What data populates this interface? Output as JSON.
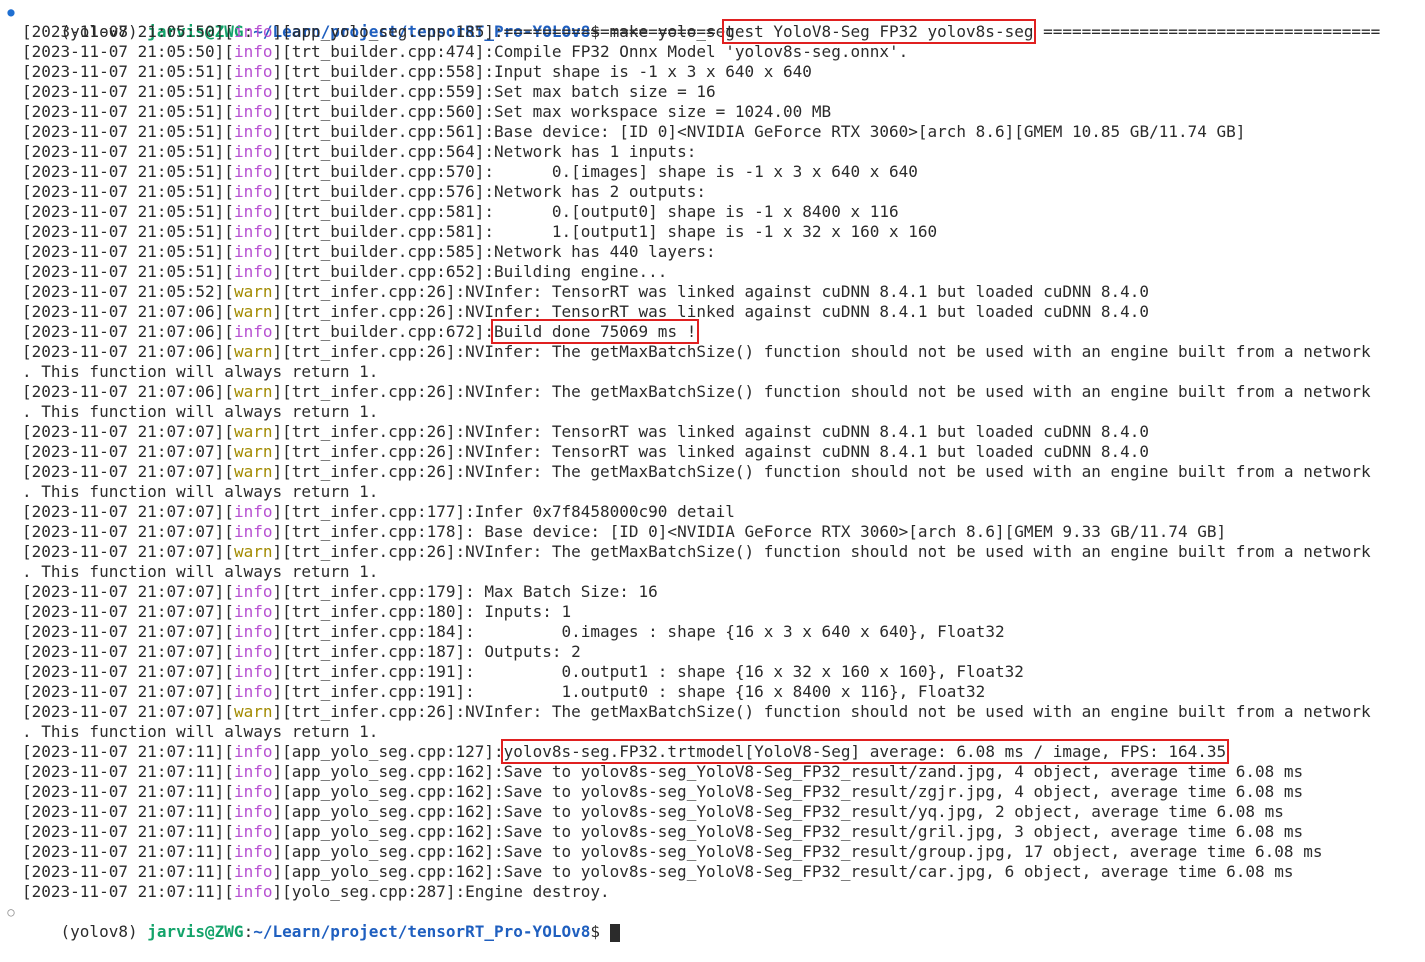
{
  "prompt": {
    "env": "(yolov8)",
    "user_host": "jarvis@ZWG",
    "path": "~/Learn/project/tensorRT_Pro-YOLOv8",
    "dollar": "$",
    "command": "make yolo_seg"
  },
  "lines": [
    {
      "ts": "[2023-11-07 21:05:50]",
      "level": "info",
      "src": "[app_yolo_seg.cpp:185]",
      "pre": ":====================== ",
      "hl": "test YoloV8-Seg FP32 yolov8s-seg",
      "post": " ==================================="
    },
    {
      "ts": "[2023-11-07 21:05:50]",
      "level": "info",
      "src": "[trt_builder.cpp:474]",
      "pre": ":Compile FP32 Onnx Model 'yolov8s-seg.onnx'."
    },
    {
      "ts": "[2023-11-07 21:05:51]",
      "level": "info",
      "src": "[trt_builder.cpp:558]",
      "pre": ":Input shape is -1 x 3 x 640 x 640"
    },
    {
      "ts": "[2023-11-07 21:05:51]",
      "level": "info",
      "src": "[trt_builder.cpp:559]",
      "pre": ":Set max batch size = 16"
    },
    {
      "ts": "[2023-11-07 21:05:51]",
      "level": "info",
      "src": "[trt_builder.cpp:560]",
      "pre": ":Set max workspace size = 1024.00 MB"
    },
    {
      "ts": "[2023-11-07 21:05:51]",
      "level": "info",
      "src": "[trt_builder.cpp:561]",
      "pre": ":Base device: [ID 0]<NVIDIA GeForce RTX 3060>[arch 8.6][GMEM 10.85 GB/11.74 GB]"
    },
    {
      "ts": "[2023-11-07 21:05:51]",
      "level": "info",
      "src": "[trt_builder.cpp:564]",
      "pre": ":Network has 1 inputs:"
    },
    {
      "ts": "[2023-11-07 21:05:51]",
      "level": "info",
      "src": "[trt_builder.cpp:570]",
      "pre": ":      0.[images] shape is -1 x 3 x 640 x 640"
    },
    {
      "ts": "[2023-11-07 21:05:51]",
      "level": "info",
      "src": "[trt_builder.cpp:576]",
      "pre": ":Network has 2 outputs:"
    },
    {
      "ts": "[2023-11-07 21:05:51]",
      "level": "info",
      "src": "[trt_builder.cpp:581]",
      "pre": ":      0.[output0] shape is -1 x 8400 x 116"
    },
    {
      "ts": "[2023-11-07 21:05:51]",
      "level": "info",
      "src": "[trt_builder.cpp:581]",
      "pre": ":      1.[output1] shape is -1 x 32 x 160 x 160"
    },
    {
      "ts": "[2023-11-07 21:05:51]",
      "level": "info",
      "src": "[trt_builder.cpp:585]",
      "pre": ":Network has 440 layers:"
    },
    {
      "ts": "[2023-11-07 21:05:51]",
      "level": "info",
      "src": "[trt_builder.cpp:652]",
      "pre": ":Building engine..."
    },
    {
      "ts": "[2023-11-07 21:05:52]",
      "level": "warn",
      "src": "[trt_infer.cpp:26]",
      "pre": ":NVInfer: TensorRT was linked against cuDNN 8.4.1 but loaded cuDNN 8.4.0"
    },
    {
      "ts": "[2023-11-07 21:07:06]",
      "level": "warn",
      "src": "[trt_infer.cpp:26]",
      "pre": ":NVInfer: TensorRT was linked against cuDNN 8.4.1 but loaded cuDNN 8.4.0"
    },
    {
      "ts": "[2023-11-07 21:07:06]",
      "level": "info",
      "src": "[trt_builder.cpp:672]",
      "pre": ":",
      "hl": "Build done 75069 ms !",
      "post": ""
    },
    {
      "ts": "[2023-11-07 21:07:06]",
      "level": "warn",
      "src": "[trt_infer.cpp:26]",
      "pre": ":NVInfer: The getMaxBatchSize() function should not be used with an engine built from a network"
    },
    {
      "wrap": ". This function will always return 1."
    },
    {
      "ts": "[2023-11-07 21:07:06]",
      "level": "warn",
      "src": "[trt_infer.cpp:26]",
      "pre": ":NVInfer: The getMaxBatchSize() function should not be used with an engine built from a network"
    },
    {
      "wrap": ". This function will always return 1."
    },
    {
      "ts": "[2023-11-07 21:07:07]",
      "level": "warn",
      "src": "[trt_infer.cpp:26]",
      "pre": ":NVInfer: TensorRT was linked against cuDNN 8.4.1 but loaded cuDNN 8.4.0"
    },
    {
      "ts": "[2023-11-07 21:07:07]",
      "level": "warn",
      "src": "[trt_infer.cpp:26]",
      "pre": ":NVInfer: TensorRT was linked against cuDNN 8.4.1 but loaded cuDNN 8.4.0"
    },
    {
      "ts": "[2023-11-07 21:07:07]",
      "level": "warn",
      "src": "[trt_infer.cpp:26]",
      "pre": ":NVInfer: The getMaxBatchSize() function should not be used with an engine built from a network"
    },
    {
      "wrap": ". This function will always return 1."
    },
    {
      "ts": "[2023-11-07 21:07:07]",
      "level": "info",
      "src": "[trt_infer.cpp:177]",
      "pre": ":Infer 0x7f8458000c90 detail"
    },
    {
      "ts": "[2023-11-07 21:07:07]",
      "level": "info",
      "src": "[trt_infer.cpp:178]",
      "pre": ": Base device: [ID 0]<NVIDIA GeForce RTX 3060>[arch 8.6][GMEM 9.33 GB/11.74 GB]"
    },
    {
      "ts": "[2023-11-07 21:07:07]",
      "level": "warn",
      "src": "[trt_infer.cpp:26]",
      "pre": ":NVInfer: The getMaxBatchSize() function should not be used with an engine built from a network"
    },
    {
      "wrap": ". This function will always return 1."
    },
    {
      "ts": "[2023-11-07 21:07:07]",
      "level": "info",
      "src": "[trt_infer.cpp:179]",
      "pre": ": Max Batch Size: 16"
    },
    {
      "ts": "[2023-11-07 21:07:07]",
      "level": "info",
      "src": "[trt_infer.cpp:180]",
      "pre": ": Inputs: 1"
    },
    {
      "ts": "[2023-11-07 21:07:07]",
      "level": "info",
      "src": "[trt_infer.cpp:184]",
      "pre": ":         0.images : shape {16 x 3 x 640 x 640}, Float32"
    },
    {
      "ts": "[2023-11-07 21:07:07]",
      "level": "info",
      "src": "[trt_infer.cpp:187]",
      "pre": ": Outputs: 2"
    },
    {
      "ts": "[2023-11-07 21:07:07]",
      "level": "info",
      "src": "[trt_infer.cpp:191]",
      "pre": ":         0.output1 : shape {16 x 32 x 160 x 160}, Float32"
    },
    {
      "ts": "[2023-11-07 21:07:07]",
      "level": "info",
      "src": "[trt_infer.cpp:191]",
      "pre": ":         1.output0 : shape {16 x 8400 x 116}, Float32"
    },
    {
      "ts": "[2023-11-07 21:07:07]",
      "level": "warn",
      "src": "[trt_infer.cpp:26]",
      "pre": ":NVInfer: The getMaxBatchSize() function should not be used with an engine built from a network"
    },
    {
      "wrap": ". This function will always return 1."
    },
    {
      "ts": "[2023-11-07 21:07:11]",
      "level": "info",
      "src": "[app_yolo_seg.cpp:127]",
      "pre": ":",
      "hl": "yolov8s-seg.FP32.trtmodel[YoloV8-Seg] average: 6.08 ms / image, FPS: 164.35",
      "post": ""
    },
    {
      "ts": "[2023-11-07 21:07:11]",
      "level": "info",
      "src": "[app_yolo_seg.cpp:162]",
      "pre": ":Save to yolov8s-seg_YoloV8-Seg_FP32_result/zand.jpg, 4 object, average time 6.08 ms"
    },
    {
      "ts": "[2023-11-07 21:07:11]",
      "level": "info",
      "src": "[app_yolo_seg.cpp:162]",
      "pre": ":Save to yolov8s-seg_YoloV8-Seg_FP32_result/zgjr.jpg, 4 object, average time 6.08 ms"
    },
    {
      "ts": "[2023-11-07 21:07:11]",
      "level": "info",
      "src": "[app_yolo_seg.cpp:162]",
      "pre": ":Save to yolov8s-seg_YoloV8-Seg_FP32_result/yq.jpg, 2 object, average time 6.08 ms"
    },
    {
      "ts": "[2023-11-07 21:07:11]",
      "level": "info",
      "src": "[app_yolo_seg.cpp:162]",
      "pre": ":Save to yolov8s-seg_YoloV8-Seg_FP32_result/gril.jpg, 3 object, average time 6.08 ms"
    },
    {
      "ts": "[2023-11-07 21:07:11]",
      "level": "info",
      "src": "[app_yolo_seg.cpp:162]",
      "pre": ":Save to yolov8s-seg_YoloV8-Seg_FP32_result/group.jpg, 17 object, average time 6.08 ms"
    },
    {
      "ts": "[2023-11-07 21:07:11]",
      "level": "info",
      "src": "[app_yolo_seg.cpp:162]",
      "pre": ":Save to yolov8s-seg_YoloV8-Seg_FP32_result/car.jpg, 6 object, average time 6.08 ms"
    },
    {
      "ts": "[2023-11-07 21:07:11]",
      "level": "info",
      "src": "[yolo_seg.cpp:287]",
      "pre": ":Engine destroy."
    }
  ],
  "colors": {
    "info": "#b64fd1",
    "warn": "#a28a00",
    "user": "#13a36a",
    "path": "#1f5fbf",
    "highlight": "#e02020"
  },
  "icons": {
    "status_done": "filled-circle-icon",
    "status_idle": "hollow-circle-icon"
  }
}
